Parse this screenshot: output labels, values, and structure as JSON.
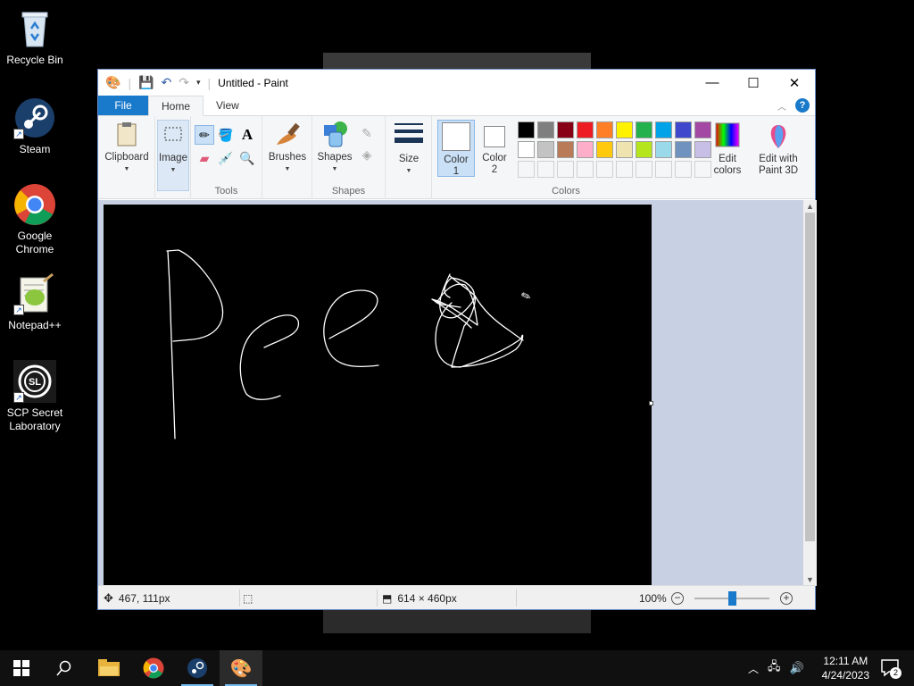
{
  "desktop": {
    "icons": [
      {
        "label": "Recycle Bin",
        "icon": "recycle-bin-icon"
      },
      {
        "label": "Steam",
        "icon": "steam-icon"
      },
      {
        "label": "Google Chrome",
        "icon": "chrome-icon"
      },
      {
        "label": "Notepad++",
        "icon": "notepad-plus-plus-icon"
      },
      {
        "label": "SCP Secret Laboratory",
        "icon": "scp-sl-icon"
      }
    ]
  },
  "paint": {
    "title": "Untitled - Paint",
    "tabs": {
      "file": "File",
      "home": "Home",
      "view": "View"
    },
    "ribbon": {
      "clipboard": "Clipboard",
      "image": "Image",
      "tools_group": "Tools",
      "brushes": "Brushes",
      "shapes": "Shapes",
      "shapes_group": "Shapes",
      "size": "Size",
      "color1": "Color 1",
      "color1_line1": "Color",
      "color1_line2": "1",
      "color2_line1": "Color",
      "color2_line2": "2",
      "colors_group": "Colors",
      "edit_colors_line1": "Edit",
      "edit_colors_line2": "colors",
      "paint3d_line1": "Edit with",
      "paint3d_line2": "Paint 3D"
    },
    "palette_row1": [
      "#000000",
      "#7f7f7f",
      "#880015",
      "#ed1c24",
      "#ff7f27",
      "#fff200",
      "#22b14c",
      "#00a2e8",
      "#3f48cc",
      "#a349a4"
    ],
    "palette_row2": [
      "#ffffff",
      "#c3c3c3",
      "#b97a57",
      "#ffaec9",
      "#ffc90e",
      "#efe4b0",
      "#b5e61d",
      "#99d9ea",
      "#7092be",
      "#c8bfe7"
    ],
    "status": {
      "cursor_pos": "467, 111px",
      "canvas_size": "614 × 460px",
      "zoom": "100%"
    }
  },
  "taskbar": {
    "time": "12:11 AM",
    "date": "4/24/2023",
    "notifications": "2"
  }
}
